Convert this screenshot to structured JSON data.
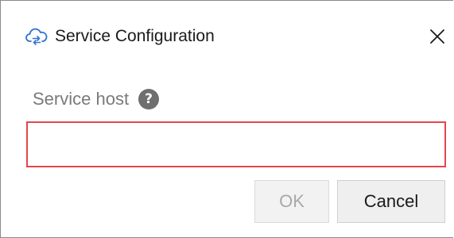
{
  "window": {
    "title": "Service Configuration",
    "title_icon": "cloud-sync-icon",
    "close_icon": "close-icon"
  },
  "form": {
    "host_label": "Service host",
    "help_icon": "help-icon",
    "help_glyph": "?",
    "host_value": "",
    "host_state": "invalid",
    "invalid_border_color": "#e5454d"
  },
  "buttons": {
    "ok_label": "OK",
    "ok_enabled": false,
    "cancel_label": "Cancel"
  },
  "colors": {
    "accent": "#2e74d4",
    "help_bg": "#6f6f6f"
  }
}
